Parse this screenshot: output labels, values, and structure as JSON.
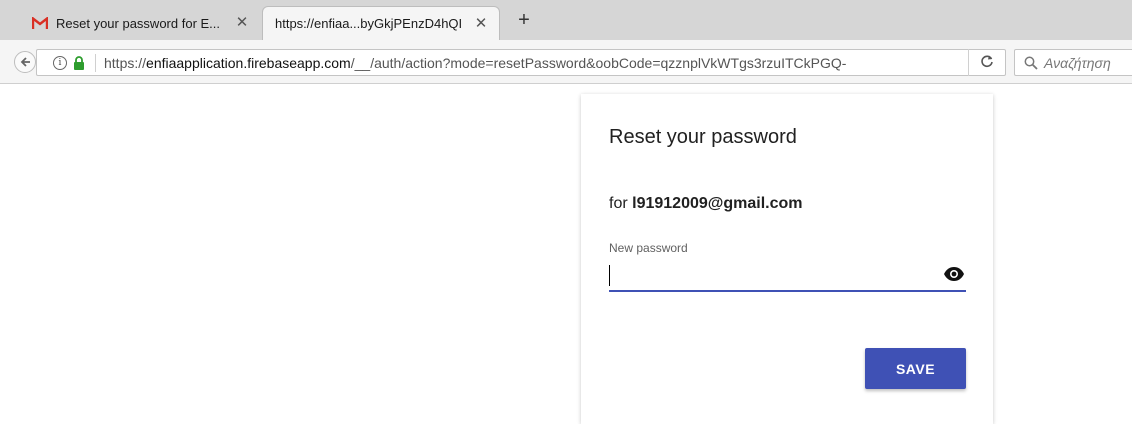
{
  "browser": {
    "tabs": [
      {
        "label": "Reset your password for E...",
        "favicon": "gmail-icon",
        "active": false
      },
      {
        "label": "https://enfiaa...byGkjPEnzD4hQI",
        "favicon": "",
        "active": true
      }
    ],
    "tab_close_glyph": "✕",
    "new_tab_glyph": "+",
    "url": {
      "prefix": "https://",
      "domain": "enfiaapplication.firebaseapp.com",
      "path": "/__/auth/action?mode=resetPassword&oobCode=qzznplVkWTgs3rzuITCkPGQ-"
    },
    "search_placeholder": "Αναζήτηση",
    "colors": {
      "gmail_red": "#d93025",
      "lock_green": "#2e9d2e"
    }
  },
  "card": {
    "title": "Reset your password",
    "for_prefix": "for ",
    "email": "l91912009@gmail.com",
    "field_label": "New password",
    "field_value": "",
    "save_label": "SAVE",
    "accent": "#3f51b5"
  }
}
